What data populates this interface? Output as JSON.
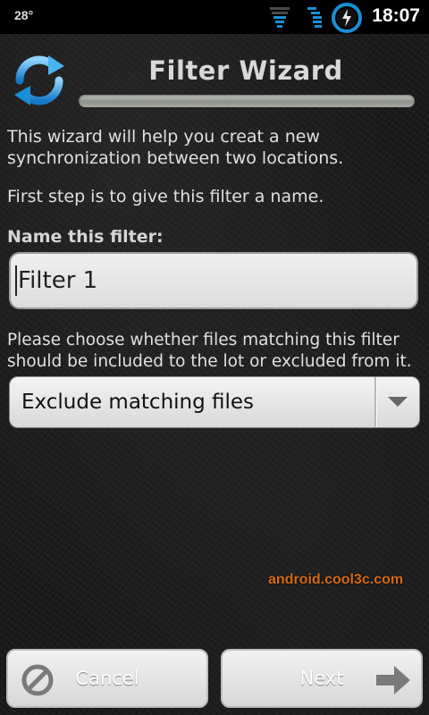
{
  "status_bar": {
    "temperature": "28°",
    "time": "18:07",
    "icons": [
      "signal-icon",
      "wifi-icon",
      "battery-charging-icon"
    ]
  },
  "header": {
    "title": "Filter Wizard",
    "progress": 1.0,
    "app_icon": "sync-icon"
  },
  "content": {
    "intro": "This wizard will help you creat a new synchronization between two locations.",
    "step": "First step is to give this filter a name.",
    "name_label": "Name this filter:",
    "name_value": "Filter 1",
    "choose_text": "Please choose whether files matching this filter should be included to the lot or excluded from it.",
    "filter_mode": "Exclude matching files"
  },
  "watermark": "android.cool3c.com",
  "buttons": {
    "cancel": "Cancel",
    "next": "Next"
  },
  "colors": {
    "accent_blue": "#1a8fd6",
    "watermark": "#d36a14"
  }
}
